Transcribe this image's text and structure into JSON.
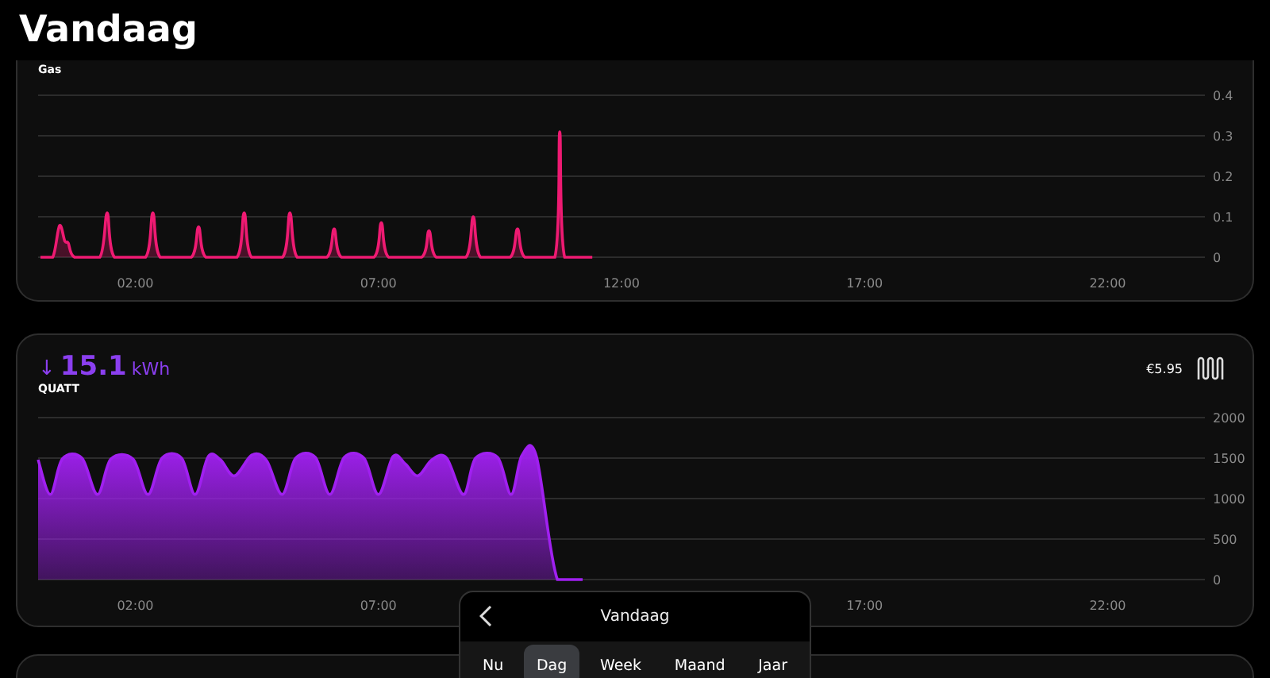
{
  "page_title": "Vandaag",
  "gas_card": {
    "label": "Gas",
    "chart_data": {
      "type": "area",
      "x": [
        0.05,
        0.3,
        0.44,
        0.55,
        0.62,
        0.75,
        1.27,
        1.42,
        1.57,
        2.21,
        2.36,
        2.51,
        3.15,
        3.3,
        3.45,
        4.09,
        4.24,
        4.39,
        5.03,
        5.18,
        5.33,
        5.94,
        6.09,
        6.24,
        6.91,
        7.06,
        7.21,
        7.89,
        8.04,
        8.19,
        8.8,
        8.95,
        9.1,
        9.71,
        9.86,
        10.01,
        10.63,
        10.73,
        10.83,
        11.4
      ],
      "series": [
        {
          "color": "#ee1a72",
          "values": [
            0,
            0,
            0.078,
            0.04,
            0.035,
            0,
            0,
            0.11,
            0,
            0,
            0.11,
            0,
            0,
            0.075,
            0,
            0,
            0.11,
            0,
            0,
            0.11,
            0,
            0,
            0.07,
            0,
            0,
            0.085,
            0,
            0,
            0.065,
            0,
            0,
            0.1,
            0,
            0,
            0.07,
            0,
            0,
            0.31,
            0,
            0
          ]
        }
      ],
      "grid": true,
      "xlim": [
        0,
        24
      ],
      "ylim": [
        0,
        0.4
      ],
      "xticks": [
        {
          "value": 2,
          "label": "02:00"
        },
        {
          "value": 7,
          "label": "07:00"
        },
        {
          "value": 12,
          "label": "12:00"
        },
        {
          "value": 17,
          "label": "17:00"
        },
        {
          "value": 22,
          "label": "22:00"
        }
      ],
      "yticks": [
        0,
        0.1,
        0.2,
        0.3,
        0.4
      ]
    }
  },
  "electricity_card": {
    "direction_arrow": "↓",
    "value": "15.1",
    "unit": "kWh",
    "label": "QUATT",
    "cost": "€5.95",
    "chart_data": {
      "type": "area",
      "x": [
        0,
        0.25,
        0.5,
        0.9,
        1.22,
        1.5,
        1.95,
        2.26,
        2.55,
        2.95,
        3.23,
        3.5,
        3.75,
        4.04,
        4.4,
        4.7,
        5.02,
        5.3,
        5.7,
        6.0,
        6.3,
        6.7,
        7.0,
        7.3,
        7.55,
        7.81,
        8.1,
        8.4,
        8.75,
        9.0,
        9.45,
        9.73,
        9.95,
        10.25,
        10.68,
        11.2
      ],
      "series": [
        {
          "color": "#a020f0",
          "values": [
            1480,
            1050,
            1490,
            1500,
            1050,
            1490,
            1490,
            1050,
            1500,
            1500,
            1050,
            1520,
            1480,
            1280,
            1540,
            1470,
            1050,
            1500,
            1510,
            1050,
            1510,
            1500,
            1050,
            1520,
            1430,
            1280,
            1480,
            1500,
            1050,
            1500,
            1510,
            1050,
            1530,
            1520,
            0,
            0
          ]
        }
      ],
      "grid": true,
      "xlim": [
        0,
        24
      ],
      "ylim": [
        0,
        2000
      ],
      "xticks": [
        {
          "value": 2,
          "label": "02:00"
        },
        {
          "value": 7,
          "label": "07:00"
        },
        {
          "value": 17,
          "label": "17:00"
        },
        {
          "value": 22,
          "label": "22:00"
        }
      ],
      "yticks": [
        0,
        500,
        1000,
        1500,
        2000
      ]
    }
  },
  "period_picker": {
    "title": "Vandaag",
    "tabs": [
      {
        "label": "Nu",
        "selected": false
      },
      {
        "label": "Dag",
        "selected": true
      },
      {
        "label": "Week",
        "selected": false
      },
      {
        "label": "Maand",
        "selected": false
      },
      {
        "label": "Jaar",
        "selected": false
      }
    ]
  }
}
